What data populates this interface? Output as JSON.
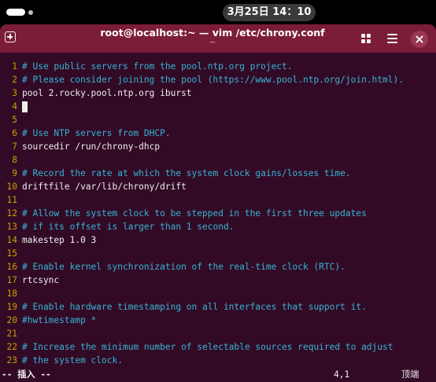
{
  "topbar": {
    "clock": "3月25日 14：10"
  },
  "window": {
    "title": "root@localhost:~ — vim /etc/chrony.conf",
    "subtitle": "~"
  },
  "editor": {
    "lines": [
      {
        "num": "1",
        "text": "# Use public servers from the pool.ntp.org project.",
        "kind": "comment"
      },
      {
        "num": "2",
        "text": "# Please consider joining the pool (https://www.pool.ntp.org/join.html).",
        "kind": "comment"
      },
      {
        "num": "3",
        "text": "pool 2.rocky.pool.ntp.org iburst",
        "kind": "code"
      },
      {
        "num": "4",
        "text": "",
        "kind": "code"
      },
      {
        "num": "5",
        "text": "",
        "kind": "code"
      },
      {
        "num": "6",
        "text": "# Use NTP servers from DHCP.",
        "kind": "comment"
      },
      {
        "num": "7",
        "text": "sourcedir /run/chrony-dhcp",
        "kind": "code"
      },
      {
        "num": "8",
        "text": "",
        "kind": "code"
      },
      {
        "num": "9",
        "text": "# Record the rate at which the system clock gains/losses time.",
        "kind": "comment"
      },
      {
        "num": "10",
        "text": "driftfile /var/lib/chrony/drift",
        "kind": "code"
      },
      {
        "num": "11",
        "text": "",
        "kind": "code"
      },
      {
        "num": "12",
        "text": "# Allow the system clock to be stepped in the first three updates",
        "kind": "comment"
      },
      {
        "num": "13",
        "text": "# if its offset is larger than 1 second.",
        "kind": "comment"
      },
      {
        "num": "14",
        "text": "makestep 1.0 3",
        "kind": "code"
      },
      {
        "num": "15",
        "text": "",
        "kind": "code"
      },
      {
        "num": "16",
        "text": "# Enable kernel synchronization of the real-time clock (RTC).",
        "kind": "comment"
      },
      {
        "num": "17",
        "text": "rtcsync",
        "kind": "code"
      },
      {
        "num": "18",
        "text": "",
        "kind": "code"
      },
      {
        "num": "19",
        "text": "# Enable hardware timestamping on all interfaces that support it.",
        "kind": "comment"
      },
      {
        "num": "20",
        "text": "#hwtimestamp *",
        "kind": "comment"
      },
      {
        "num": "21",
        "text": "",
        "kind": "code"
      },
      {
        "num": "22",
        "text": "# Increase the minimum number of selectable sources required to adjust",
        "kind": "comment"
      },
      {
        "num": "23",
        "text": "# the system clock.",
        "kind": "comment"
      }
    ],
    "cursor_line": "4"
  },
  "status": {
    "mode": "-- 插入 --",
    "position": "4,1",
    "scroll": "顶端"
  },
  "colors": {
    "header_bg": "#7c1d38",
    "terminal_bg": "#330a26",
    "line_number": "#c4a000",
    "comment": "#34b5d4"
  },
  "icons": [
    "new-tab-icon",
    "grid-view-icon",
    "hamburger-menu-icon",
    "close-icon"
  ]
}
